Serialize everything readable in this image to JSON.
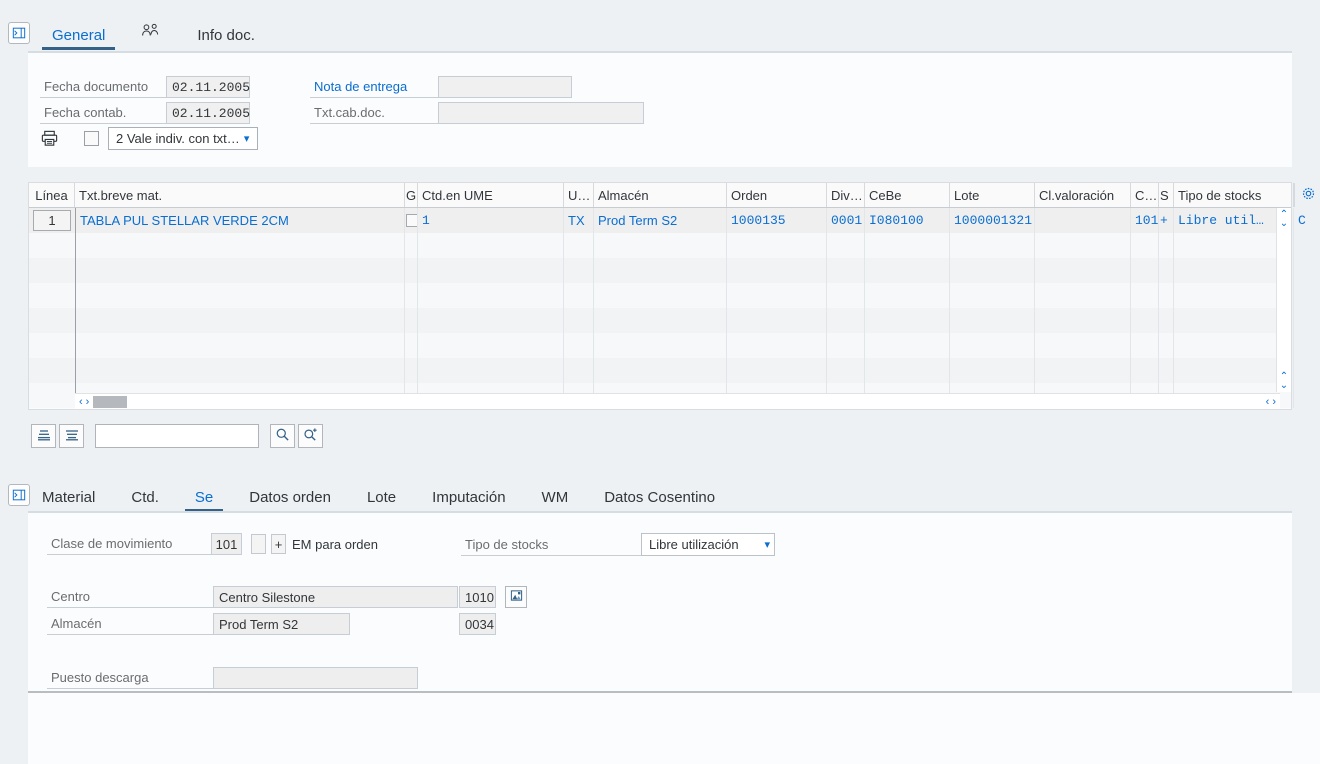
{
  "top_tabs": [
    {
      "label": "General",
      "selected": true
    },
    {
      "label": "",
      "icon": "people-icon",
      "selected": false
    },
    {
      "label": "Info doc.",
      "selected": false
    }
  ],
  "header_form": {
    "fecha_documento": {
      "label": "Fecha documento",
      "value": "02.11.2005"
    },
    "fecha_contab": {
      "label": "Fecha contab.",
      "value": "02.11.2005"
    },
    "nota_entrega": {
      "label": "Nota de entrega",
      "value": ""
    },
    "txt_cab_doc": {
      "label": "Txt.cab.doc.",
      "value": ""
    },
    "print_icon": "printer-icon",
    "print_checkbox_checked": false,
    "print_option": {
      "value": "2 Vale indiv. con txt…"
    }
  },
  "items_table": {
    "columns": [
      "Línea",
      "Txt.breve mat.",
      "G",
      "Ctd.en UME",
      "U…",
      "Almacén",
      "Orden",
      "Div…",
      "CeBe",
      "Lote",
      "Cl.valoración",
      "C…",
      "S",
      "Tipo de stocks"
    ],
    "settings_icon": "gear-icon",
    "rows": [
      {
        "linea": "1",
        "txt_breve_mat": "TABLA PUL STELLAR VERDE 2CM",
        "g_checked": false,
        "ctd_en_ume": "1",
        "u": "TX",
        "almacen": "Prod Term S2",
        "orden": "1000135",
        "div": "0001",
        "cebe": "I080100",
        "lote": "1000001321",
        "cl_valoracion": "",
        "c": "101",
        "s": "+",
        "tipo_de_stocks": "Libre util…",
        "trailing": "C"
      }
    ],
    "empty_row_count": 7,
    "hscroll": {
      "left_arrow": "‹",
      "right_arrow": "›"
    },
    "vscroll": {
      "up_arrow": "⌃",
      "down_arrow": "⌄"
    }
  },
  "search_toolbar": {
    "sort_button": "sort-lines-icon",
    "filter_button": "filter-lines-icon",
    "input_value": "",
    "input_placeholder": "",
    "search_button": "search-icon",
    "advanced_search_button": "search-plus-icon"
  },
  "lower_tabs": [
    {
      "label": "Material",
      "selected": false
    },
    {
      "label": "Ctd.",
      "selected": false
    },
    {
      "label": "Se",
      "selected": true
    },
    {
      "label": "Datos orden",
      "selected": false
    },
    {
      "label": "Lote",
      "selected": false
    },
    {
      "label": "Imputación",
      "selected": false
    },
    {
      "label": "WM",
      "selected": false
    },
    {
      "label": "Datos Cosentino",
      "selected": false
    }
  ],
  "detail_form": {
    "clase_movimiento": {
      "label": "Clase de movimiento",
      "value": "101"
    },
    "plus_sign": "+",
    "em_para_orden": "EM para orden",
    "tipo_de_stocks": {
      "label": "Tipo de stocks",
      "value": "Libre utilización"
    },
    "centro": {
      "label": "Centro",
      "value": "Centro Silestone",
      "code": "1010",
      "icon": "image-picker-icon"
    },
    "almacen": {
      "label": "Almacén",
      "value": "Prod Term S2",
      "code": "0034"
    },
    "puesto_descarga": {
      "label": "Puesto descarga",
      "value": ""
    }
  },
  "colors": {
    "accent": "#0a6ed1",
    "tab_underline": "#346187",
    "label": "#6a6d70",
    "page_bg": "#edf1f4",
    "panel_bg": "#fbfcfd"
  }
}
